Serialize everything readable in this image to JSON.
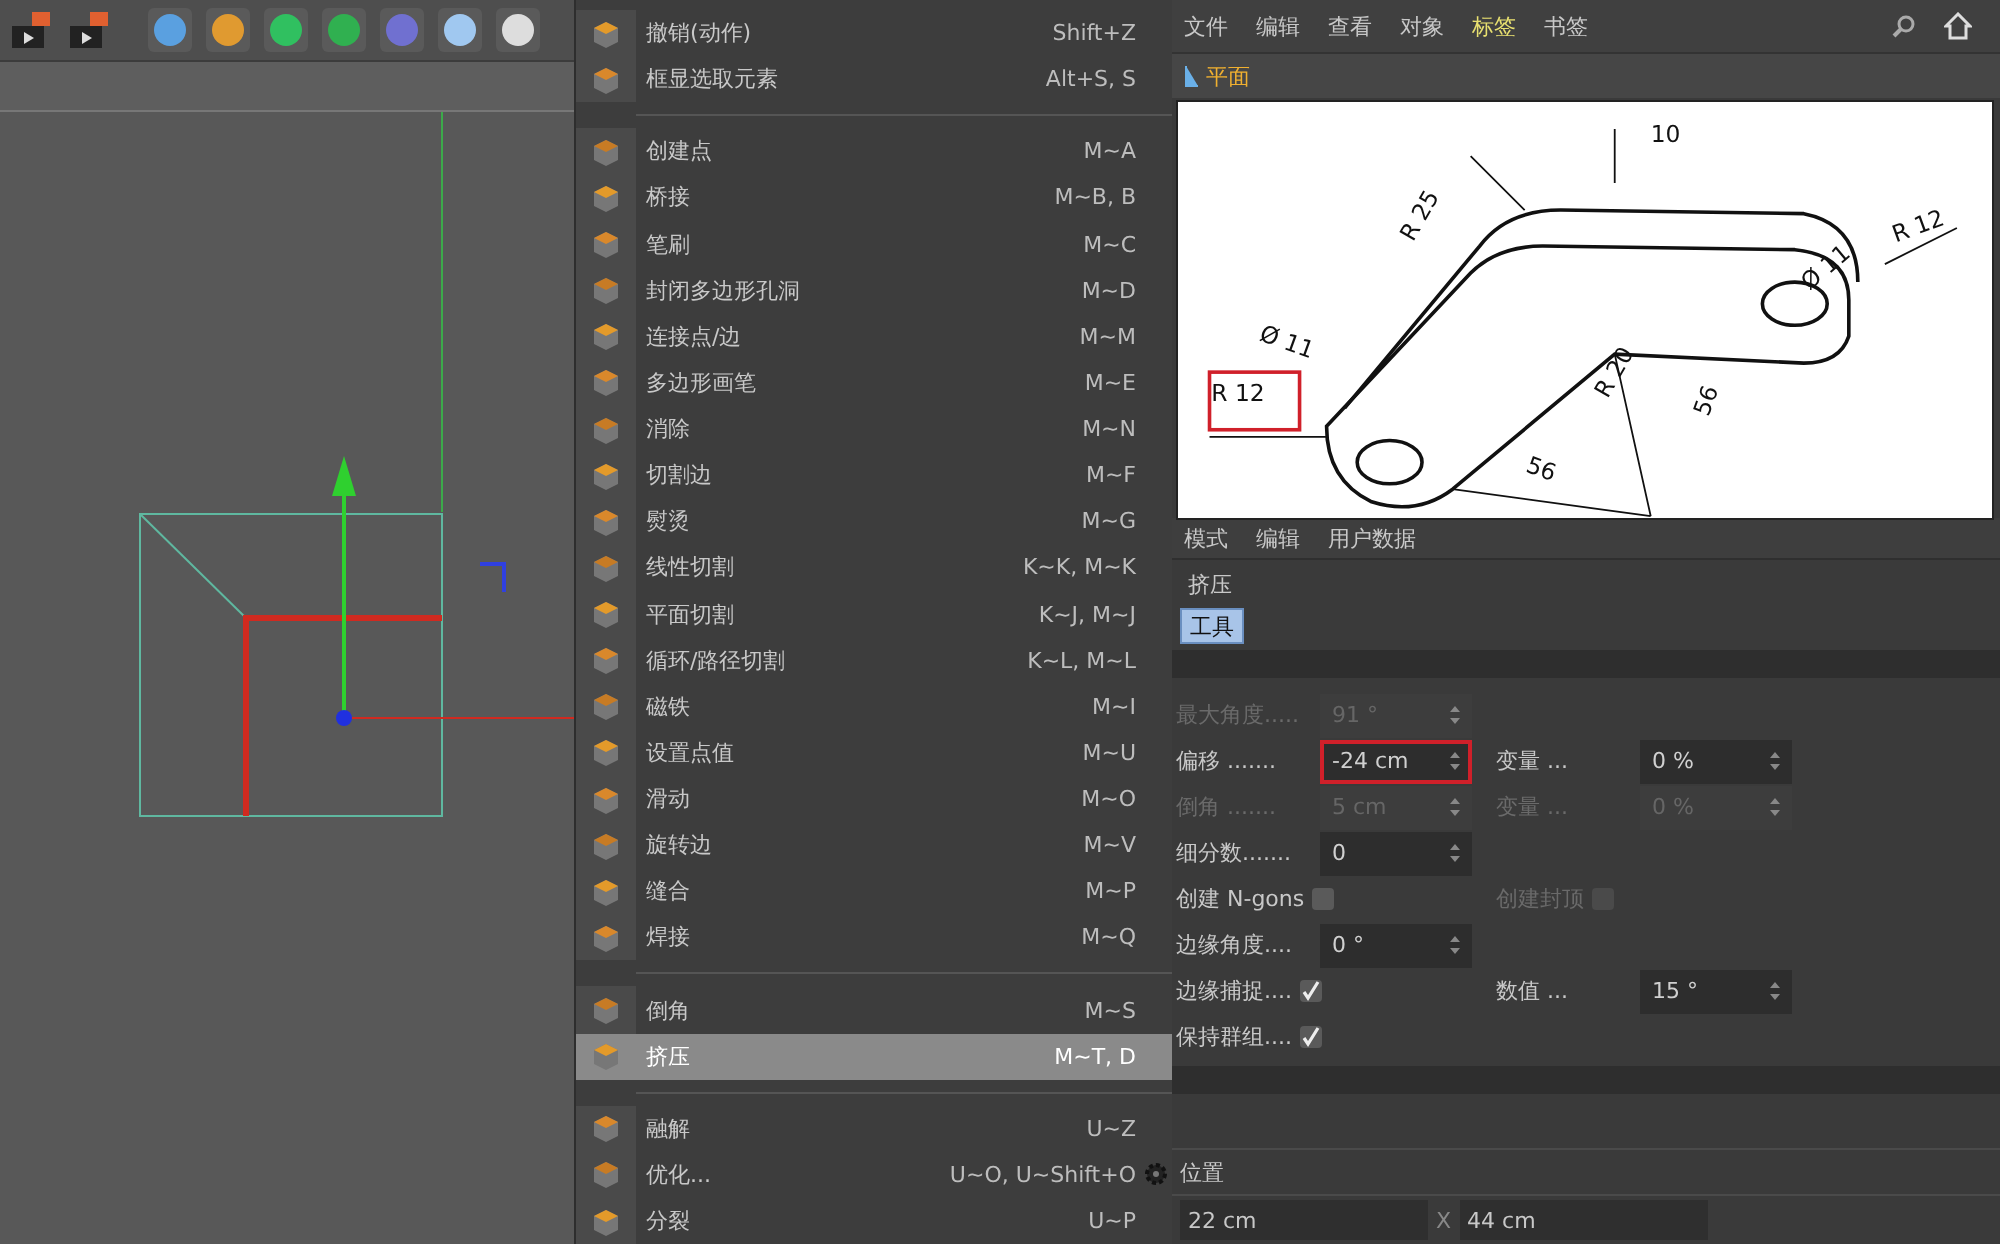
{
  "menu": {
    "groups": [
      [
        {
          "label": "撤销(动作)",
          "shortcut": "Shift+Z",
          "selected": false,
          "options": false
        },
        {
          "label": "框显选取元素",
          "shortcut": "Alt+S, S",
          "selected": false,
          "options": false
        }
      ],
      [
        {
          "label": "创建点",
          "shortcut": "M~A",
          "selected": false,
          "options": false
        },
        {
          "label": "桥接",
          "shortcut": "M~B, B",
          "selected": false,
          "options": false
        },
        {
          "label": "笔刷",
          "shortcut": "M~C",
          "selected": false,
          "options": false
        },
        {
          "label": "封闭多边形孔洞",
          "shortcut": "M~D",
          "selected": false,
          "options": false
        },
        {
          "label": "连接点/边",
          "shortcut": "M~M",
          "selected": false,
          "options": false
        },
        {
          "label": "多边形画笔",
          "shortcut": "M~E",
          "selected": false,
          "options": false
        },
        {
          "label": "消除",
          "shortcut": "M~N",
          "selected": false,
          "options": false
        },
        {
          "label": "切割边",
          "shortcut": "M~F",
          "selected": false,
          "options": false
        },
        {
          "label": "熨烫",
          "shortcut": "M~G",
          "selected": false,
          "options": false
        },
        {
          "label": "线性切割",
          "shortcut": "K~K, M~K",
          "selected": false,
          "options": false
        },
        {
          "label": "平面切割",
          "shortcut": "K~J, M~J",
          "selected": false,
          "options": false
        },
        {
          "label": "循环/路径切割",
          "shortcut": "K~L, M~L",
          "selected": false,
          "options": false
        },
        {
          "label": "磁铁",
          "shortcut": "M~I",
          "selected": false,
          "options": false
        },
        {
          "label": "设置点值",
          "shortcut": "M~U",
          "selected": false,
          "options": false
        },
        {
          "label": "滑动",
          "shortcut": "M~O",
          "selected": false,
          "options": false
        },
        {
          "label": "旋转边",
          "shortcut": "M~V",
          "selected": false,
          "options": false
        },
        {
          "label": "缝合",
          "shortcut": "M~P",
          "selected": false,
          "options": false
        },
        {
          "label": "焊接",
          "shortcut": "M~Q",
          "selected": false,
          "options": false
        }
      ],
      [
        {
          "label": "倒角",
          "shortcut": "M~S",
          "selected": false,
          "options": false
        },
        {
          "label": "挤压",
          "shortcut": "M~T, D",
          "selected": true,
          "options": false
        }
      ],
      [
        {
          "label": "融解",
          "shortcut": "U~Z",
          "selected": false,
          "options": false
        },
        {
          "label": "优化...",
          "shortcut": "U~O, U~Shift+O",
          "selected": false,
          "options": true
        },
        {
          "label": "分裂",
          "shortcut": "U~P",
          "selected": false,
          "options": false
        }
      ]
    ]
  },
  "menubar": [
    {
      "label": "文件",
      "selected": false
    },
    {
      "label": "编辑",
      "selected": false
    },
    {
      "label": "查看",
      "selected": false
    },
    {
      "label": "对象",
      "selected": false
    },
    {
      "label": "标签",
      "selected": true
    },
    {
      "label": "书签",
      "selected": false
    }
  ],
  "toolbar": {
    "button": "平面"
  },
  "drawing": {
    "labels": [
      "10",
      "R 25",
      "Ø 11",
      "R 12",
      "Ø 11",
      "R 12",
      "R 20",
      "56",
      "56"
    ]
  },
  "attributes": {
    "menubar": [
      "模式",
      "编辑",
      "用户数据"
    ],
    "title": "挤压",
    "tabs": [
      {
        "label": "工具",
        "selected": true
      }
    ],
    "rows": [
      [
        {
          "kind": "number",
          "label": "最大角度.....",
          "value": "91 °",
          "disabled": true,
          "highlighted": false
        }
      ],
      [
        {
          "kind": "number",
          "label": "偏移 .......",
          "value": "-24 cm",
          "disabled": false,
          "highlighted": true
        },
        {
          "kind": "number",
          "label": "变量 ...",
          "value": "0 %",
          "disabled": false,
          "highlighted": false
        }
      ],
      [
        {
          "kind": "number",
          "label": "倒角 .......",
          "value": "5 cm",
          "disabled": true,
          "highlighted": false
        },
        {
          "kind": "number",
          "label": "变量 ...",
          "value": "0 %",
          "disabled": true,
          "highlighted": false
        }
      ],
      [
        {
          "kind": "number",
          "label": "细分数.......",
          "value": "0",
          "disabled": false,
          "highlighted": false
        }
      ],
      [
        {
          "kind": "checkbox",
          "label": "创建 N-gons",
          "checked": false,
          "disabled": false
        },
        {
          "kind": "checkbox",
          "label": "创建封顶",
          "checked": false,
          "disabled": true
        }
      ],
      [
        {
          "kind": "number",
          "label": "边缘角度....",
          "value": "0 °",
          "disabled": false,
          "highlighted": false
        }
      ],
      [
        {
          "kind": "checkbox",
          "label": "边缘捕捉....",
          "checked": true,
          "disabled": false
        },
        {
          "kind": "number",
          "label": "数值 ...",
          "value": "15 °",
          "disabled": false,
          "highlighted": false
        }
      ],
      [
        {
          "kind": "checkbox",
          "label": "保持群组....",
          "checked": true,
          "disabled": false
        }
      ]
    ]
  },
  "coordinates": {
    "label": "位置",
    "value": "22 cm",
    "axis": "X",
    "column_2_value": "44 cm"
  }
}
